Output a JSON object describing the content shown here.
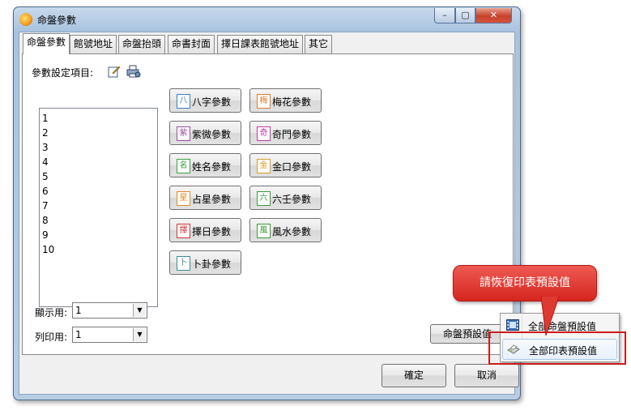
{
  "window": {
    "title": "命盤參數"
  },
  "tabs": [
    {
      "label": "命盤參數",
      "active": true
    },
    {
      "label": "館號地址"
    },
    {
      "label": "命盤抬頭"
    },
    {
      "label": "命書封面"
    },
    {
      "label": "擇日課表館號地址"
    },
    {
      "label": "其它"
    }
  ],
  "params": {
    "label": "參數設定項目:",
    "list": [
      "1",
      "2",
      "3",
      "4",
      "5",
      "6",
      "7",
      "8",
      "9",
      "10"
    ]
  },
  "buttons": [
    {
      "label": "八字參數",
      "icon": "八",
      "color": "#3a7fc8"
    },
    {
      "label": "梅花參數",
      "icon": "梅",
      "color": "#e07a2a"
    },
    {
      "label": "紫微參數",
      "icon": "紫",
      "color": "#9a4fa6"
    },
    {
      "label": "奇門參數",
      "icon": "奇",
      "color": "#c23aa0"
    },
    {
      "label": "姓名參數",
      "icon": "名",
      "color": "#3aa040"
    },
    {
      "label": "金口參數",
      "icon": "金",
      "color": "#d99a2a"
    },
    {
      "label": "占星參數",
      "icon": "星",
      "color": "#e08a2a"
    },
    {
      "label": "六壬參數",
      "icon": "六",
      "color": "#3a9a3a"
    },
    {
      "label": "擇日參數",
      "icon": "擇",
      "color": "#d0343a"
    },
    {
      "label": "風水參數",
      "icon": "風",
      "color": "#3a9a3a"
    },
    {
      "label": "卜卦參數",
      "icon": "卜",
      "color": "#3a8a9a"
    }
  ],
  "display": {
    "label": "顯示用:",
    "value": "1"
  },
  "print": {
    "label": "列印用:",
    "value": "1"
  },
  "preset_button": "命盤預設值",
  "menu": [
    {
      "label": "全部命盤預設值"
    },
    {
      "label": "全部印表預設值"
    }
  ],
  "callout": "請恢復印表預設值",
  "ok": "確定",
  "cancel": "取消",
  "window_buttons": {
    "min": "–",
    "max": "▢",
    "close": "✕"
  }
}
